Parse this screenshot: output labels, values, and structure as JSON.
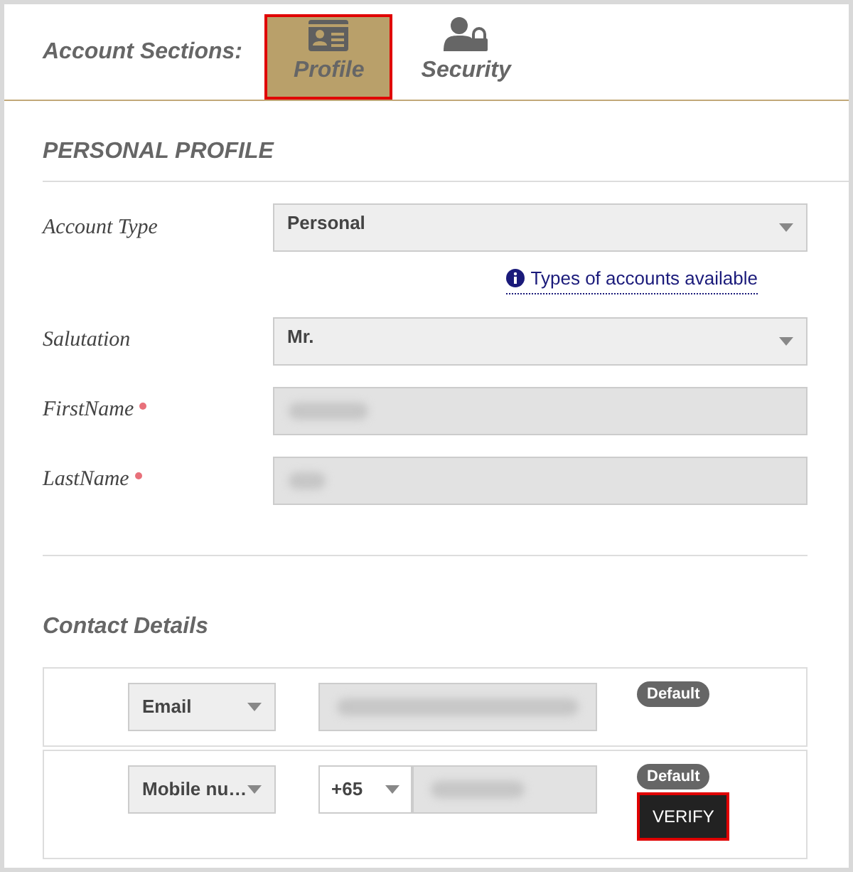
{
  "sections_label": "Account Sections:",
  "tabs": [
    {
      "label": "Profile",
      "selected": true,
      "highlighted": true
    },
    {
      "label": "Security",
      "selected": false,
      "highlighted": false
    }
  ],
  "heading": "PERSONAL PROFILE",
  "fields": [
    {
      "kind": "select",
      "label": "Account Type",
      "value": "Personal",
      "required": false,
      "help_link": "Types of accounts available"
    },
    {
      "kind": "select",
      "label": "Salutation",
      "value": "Mr.",
      "required": false
    },
    {
      "kind": "blurred",
      "label": "FirstName",
      "required": true
    },
    {
      "kind": "blurred",
      "label": "LastName",
      "required": true
    }
  ],
  "contact_heading": "Contact Details",
  "contacts": [
    {
      "type": "Email",
      "badge": "Default"
    },
    {
      "type": "Mobile nu…",
      "code": "+65",
      "badge": "Default",
      "verify": {
        "label": "VERIFY",
        "highlighted": true
      }
    }
  ]
}
